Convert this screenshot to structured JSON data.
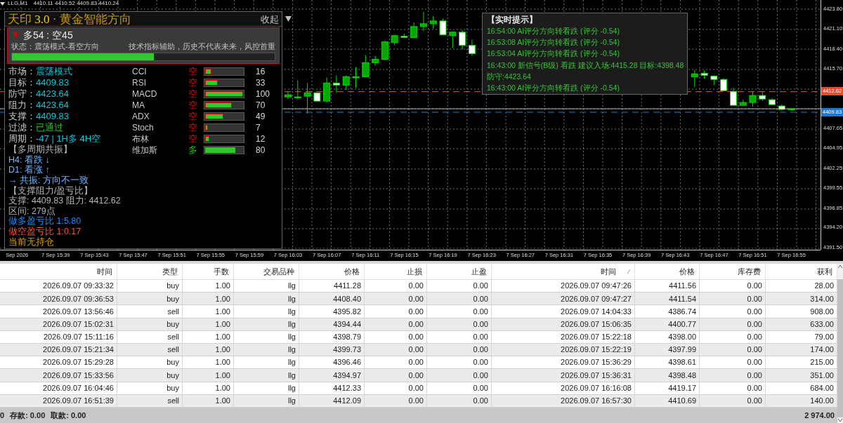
{
  "chart_header": {
    "symbol": "LLG,M1",
    "quotes": "4410.11 4410.52 4409.83 4410.24"
  },
  "panel": {
    "title": "天印",
    "version": "3.0",
    "subtitle": "· 黄金智能方向",
    "collapse_label": "收起",
    "score": {
      "arrow": "▼",
      "text": "多54 : 空45",
      "status": "状态：震荡模式-看空方向",
      "disclaimer": "技术指标辅助，历史不代表未来，风控首重",
      "level": 0.54
    },
    "info": [
      {
        "label": "市场：",
        "value": "震荡模式",
        "color": "#00c8d8"
      },
      {
        "label": "目标：",
        "value": "4409.83",
        "color": "#00c8d8"
      },
      {
        "label": "防守：",
        "value": "4423.64",
        "color": "#00c8d8"
      },
      {
        "label": "阻力：",
        "value": "4423.64",
        "color": "#00c8d8"
      },
      {
        "label": "支撑：",
        "value": "4409.83",
        "color": "#00c8d8"
      },
      {
        "label": "过滤：",
        "value": "已通过",
        "color": "#30c030"
      },
      {
        "label": "周期：",
        "value": "-47 | 1H多 4H空",
        "color": "#00c8d8"
      }
    ],
    "indicators": [
      {
        "name": "CCI",
        "direction": "空",
        "kind": "bear",
        "level": 0.16,
        "value": "16"
      },
      {
        "name": "RSI",
        "direction": "空",
        "kind": "bear",
        "level": 0.33,
        "value": "33"
      },
      {
        "name": "MACD",
        "direction": "空",
        "kind": "bear",
        "level": 1.0,
        "value": "100"
      },
      {
        "name": "MA",
        "direction": "空",
        "kind": "bear",
        "level": 0.7,
        "value": "70"
      },
      {
        "name": "ADX",
        "direction": "空",
        "kind": "bear",
        "level": 0.49,
        "value": "49"
      },
      {
        "name": "Stoch",
        "direction": "空",
        "kind": "bear",
        "level": 0.07,
        "value": "7"
      },
      {
        "name": "布林",
        "direction": "空",
        "kind": "bear",
        "level": 0.12,
        "value": "12"
      },
      {
        "name": "维加斯",
        "direction": "多",
        "kind": "bull",
        "level": 0.8,
        "value": "80"
      }
    ],
    "notes": [
      {
        "text": "【多周期共振】",
        "color": "#b4b4b4"
      },
      {
        "text": "H4: 看跌 ↓",
        "color": "#6cb4ff"
      },
      {
        "text": "D1: 看涨 ↑",
        "color": "#6cb4ff"
      },
      {
        "text": "→ 共振: 方向不一致",
        "color": "#6cb4ff"
      },
      {
        "text": "【支撑阻力/盈亏比】",
        "color": "#b4b4b4"
      },
      {
        "text": "支撑: 4409.83  阻力: 4412.62",
        "color": "#b4b4b4"
      },
      {
        "text": "区间: 279点",
        "color": "#b4b4b4"
      },
      {
        "text": "做多盈亏比 1:5.80",
        "color": "#1e8cff"
      },
      {
        "text": "做空盈亏比 1:0.17",
        "color": "#ff5030"
      },
      {
        "text": "当前无持仓",
        "color": "#e0a000"
      }
    ]
  },
  "chart": {
    "chart_data": {
      "type": "candlestick",
      "ylim": [
        4391.2,
        4425.04
      ],
      "grid": true,
      "ref_lines": [
        {
          "axis": "y",
          "value": 4412.62,
          "color": "#e05a3a"
        },
        {
          "axis": "y",
          "value": 4410.3,
          "color": "#b0b0b0"
        },
        {
          "axis": "y",
          "value": 4409.83,
          "color": "#1e78d0"
        }
      ],
      "yticks": [
        {
          "value": 4423.8,
          "label": "4423.80"
        },
        {
          "value": 4421.1,
          "label": "4421.10"
        },
        {
          "value": 4418.4,
          "label": "4418.40"
        },
        {
          "value": 4415.7,
          "label": "4415.70"
        },
        {
          "value": 4407.65,
          "label": "4407.65"
        },
        {
          "value": 4404.95,
          "label": "4404.95"
        },
        {
          "value": 4402.25,
          "label": "4402.25"
        },
        {
          "value": 4399.55,
          "label": "4399.55"
        },
        {
          "value": 4396.85,
          "label": "4396.85"
        },
        {
          "value": 4394.2,
          "label": "4394.20"
        },
        {
          "value": 4391.5,
          "label": "4391.50"
        }
      ],
      "categories": [
        "Sep 2026",
        null,
        null,
        null,
        "7 Sep 15:39",
        null,
        null,
        null,
        "7 Sep 15:43",
        null,
        null,
        null,
        "7 Sep 15:47",
        null,
        null,
        null,
        "7 Sep 15:51",
        null,
        null,
        null,
        "7 Sep 15:55",
        null,
        null,
        null,
        "7 Sep 15:59",
        null,
        null,
        null,
        "7 Sep 16:03",
        null,
        null,
        null,
        "7 Sep 16:07",
        null,
        null,
        null,
        "7 Sep 16:11",
        null,
        null,
        null,
        "7 Sep 16:15",
        null,
        null,
        null,
        "7 Sep 16:19",
        null,
        null,
        null,
        "7 Sep 16:23",
        null,
        null,
        null,
        "7 Sep 16:27",
        null,
        null,
        null,
        "7 Sep 16:31",
        null,
        null,
        null,
        "7 Sep 16:35",
        null,
        null,
        null,
        "7 Sep 16:39",
        null,
        null,
        null,
        "7 Sep 16:43",
        null,
        null,
        null,
        "7 Sep 16:47",
        null,
        null,
        null,
        "7 Sep 16:51",
        null,
        null,
        null,
        "7 Sep 16:55"
      ],
      "ohlc": [
        null,
        null,
        null,
        null,
        null,
        null,
        null,
        null,
        null,
        null,
        null,
        null,
        null,
        null,
        null,
        null,
        null,
        null,
        null,
        null,
        null,
        null,
        null,
        null,
        null,
        null,
        null,
        null,
        [
          4411.91,
          4412.66,
          4411.62,
          4412.19
        ],
        [
          4411.91,
          4414.17,
          4411.62,
          4411.91
        ],
        [
          4412.0,
          4413.79,
          4409.64,
          4412.47
        ],
        [
          4412.47,
          4412.47,
          4411.34,
          4411.34
        ],
        [
          4411.34,
          4414.55,
          4411.15,
          4413.79
        ],
        [
          4413.79,
          4414.83,
          4412.47,
          4413.51
        ],
        [
          4413.51,
          4414.83,
          4412.85,
          4414.64
        ],
        [
          4414.64,
          4415.96,
          4413.13,
          4414.64
        ],
        [
          4414.64,
          4417.57,
          4414.64,
          4416.53
        ],
        [
          4416.53,
          4417.48,
          4416.15,
          4417.0
        ],
        [
          4417.0,
          4419.55,
          4416.91,
          4419.36
        ],
        [
          4419.27,
          4420.31,
          4418.89,
          4420.21
        ],
        [
          4420.12,
          4420.5,
          4419.93,
          4420.02
        ],
        [
          4419.93,
          4422.01,
          4419.93,
          4421.44
        ],
        [
          4421.44,
          4423.42,
          4420.87,
          4421.82
        ],
        [
          4421.82,
          4422.86,
          4421.16,
          4422.2
        ],
        [
          4422.2,
          4422.48,
          4420.31,
          4420.31
        ],
        [
          4420.21,
          4420.78,
          4418.51,
          4420.68
        ],
        [
          4420.68,
          4420.97,
          4418.33,
          4418.89
        ],
        [
          4418.89,
          4419.65,
          4417.48,
          4417.76
        ],
        null,
        null,
        null,
        null,
        null,
        null,
        null,
        null,
        null,
        null,
        null,
        null,
        null,
        null,
        null,
        null,
        null,
        null,
        null,
        null,
        null,
        null,
        [
          4414.64,
          4415.59,
          4413.23,
          4415.02
        ],
        [
          4415.11,
          4415.49,
          4414.36,
          4414.83
        ],
        [
          4414.74,
          4414.83,
          4413.51,
          4414.27
        ],
        [
          4414.27,
          4414.45,
          4412.66,
          4412.75
        ],
        [
          4412.66,
          4413.13,
          4410.77,
          4410.77
        ],
        [
          4410.77,
          4411.53,
          4410.77,
          4411.15
        ],
        [
          4411.15,
          4412.66,
          4410.58,
          4412.1
        ],
        [
          4412.1,
          4412.66,
          4411.34,
          4411.62
        ],
        [
          4411.53,
          4411.72,
          4410.77,
          4410.87
        ],
        [
          4410.68,
          4410.87,
          4410.11,
          4410.21
        ],
        [
          4410.3,
          4410.39,
          4410.11,
          4410.3
        ]
      ]
    }
  },
  "alerts": {
    "title": "【实时提示】",
    "lines": [
      "16:54:00 AI评分方向转看跌 (评分 -0.54)",
      "16:53:08 AI评分方向转看跌 (评分 -0.54)",
      "16:53:04 AI评分方向转看跌 (评分 -0.54)",
      "16:43:00 新信号(B级) 看跌 建议入场:4415.28 目标:4398.48",
      "防守:4423.64",
      "16:43:00 AI评分方向转看跌 (评分 -0.54)"
    ]
  },
  "price_axis": {
    "resistance_badge": "4412.62",
    "support_badge": "4409.83"
  },
  "table": {
    "columns": [
      {
        "label": "时间",
        "sorted": false
      },
      {
        "label": "类型",
        "sorted": false
      },
      {
        "label": "手数",
        "sorted": false
      },
      {
        "label": "交易品种",
        "sorted": false
      },
      {
        "label": "价格",
        "sorted": false
      },
      {
        "label": "止损",
        "sorted": false
      },
      {
        "label": "止盈",
        "sorted": false
      },
      {
        "label": "时间",
        "sorted": true
      },
      {
        "label": "价格",
        "sorted": false
      },
      {
        "label": "库存费",
        "sorted": false
      },
      {
        "label": "获利",
        "sorted": false
      }
    ],
    "rows": [
      [
        "2026.09.07 09:33:32",
        "buy",
        "1.00",
        "llg",
        "4411.28",
        "0.00",
        "0.00",
        "2026.09.07 09:47:26",
        "4411.56",
        "0.00",
        "28.00"
      ],
      [
        "2026.09.07 09:36:53",
        "buy",
        "1.00",
        "llg",
        "4408.40",
        "0.00",
        "0.00",
        "2026.09.07 09:47:27",
        "4411.54",
        "0.00",
        "314.00"
      ],
      [
        "2026.09.07 13:56:46",
        "sell",
        "1.00",
        "llg",
        "4395.82",
        "0.00",
        "0.00",
        "2026.09.07 14:04:33",
        "4386.74",
        "0.00",
        "908.00"
      ],
      [
        "2026.09.07 15:02:31",
        "buy",
        "1.00",
        "llg",
        "4394.44",
        "0.00",
        "0.00",
        "2026.09.07 15:06:35",
        "4400.77",
        "0.00",
        "633.00"
      ],
      [
        "2026.09.07 15:11:16",
        "sell",
        "1.00",
        "llg",
        "4398.79",
        "0.00",
        "0.00",
        "2026.09.07 15:22:18",
        "4398.00",
        "0.00",
        "79.00"
      ],
      [
        "2026.09.07 15:21:34",
        "sell",
        "1.00",
        "llg",
        "4399.73",
        "0.00",
        "0.00",
        "2026.09.07 15:22:19",
        "4397.99",
        "0.00",
        "174.00"
      ],
      [
        "2026.09.07 15:29:28",
        "buy",
        "1.00",
        "llg",
        "4396.46",
        "0.00",
        "0.00",
        "2026.09.07 15:36:29",
        "4398.61",
        "0.00",
        "215.00"
      ],
      [
        "2026.09.07 15:33:56",
        "buy",
        "1.00",
        "llg",
        "4394.97",
        "0.00",
        "0.00",
        "2026.09.07 15:36:31",
        "4398.48",
        "0.00",
        "351.00"
      ],
      [
        "2026.09.07 16:04:46",
        "buy",
        "1.00",
        "llg",
        "4412.33",
        "0.00",
        "0.00",
        "2026.09.07 16:16:08",
        "4419.17",
        "0.00",
        "684.00"
      ],
      [
        "2026.09.07 16:51:39",
        "sell",
        "1.00",
        "llg",
        "4412.09",
        "0.00",
        "0.00",
        "2026.09.07 16:57:30",
        "4410.69",
        "0.00",
        "140.00"
      ]
    ],
    "footer": {
      "balance_tail": "0",
      "deposit": "存款: 0.00",
      "withdrawal": "取款: 0.00",
      "total": "2 974.00"
    }
  }
}
